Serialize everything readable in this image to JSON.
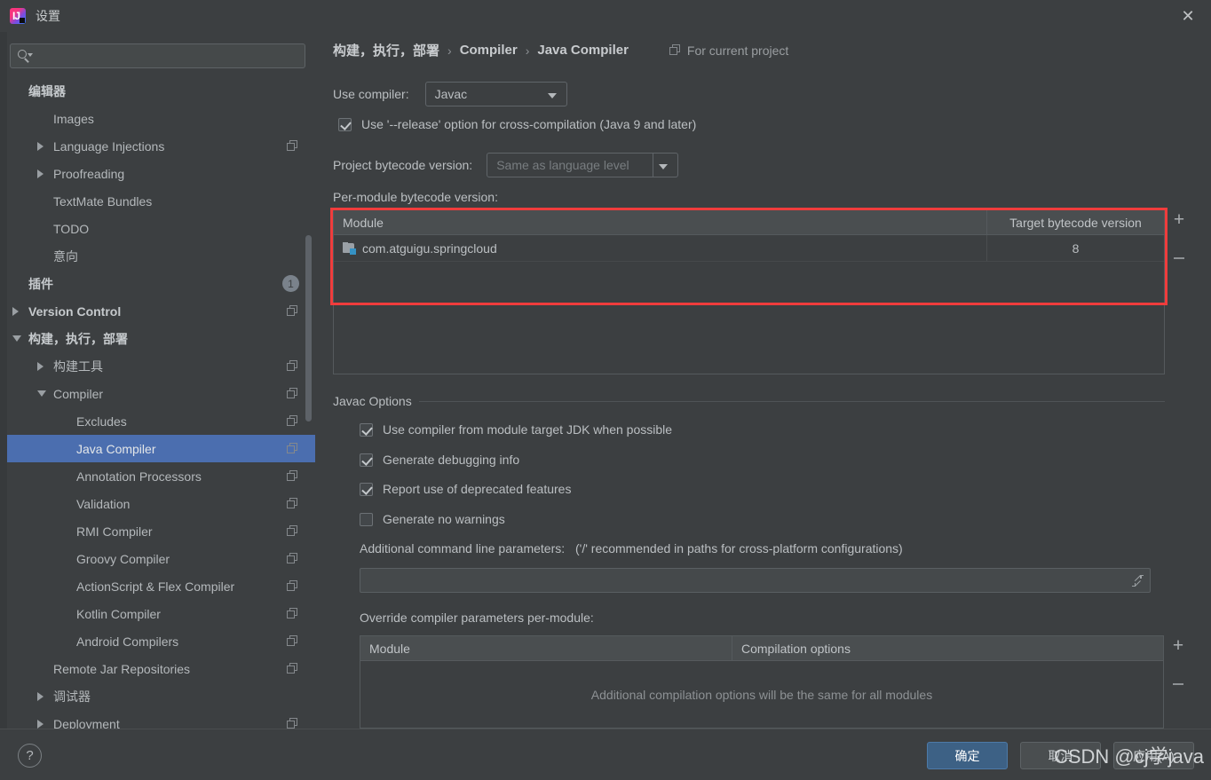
{
  "window": {
    "title": "设置",
    "app_icon": "intellij-idea-icon",
    "close_icon": "close-icon"
  },
  "search": {
    "placeholder": "",
    "value": "",
    "icon": "search-icon"
  },
  "sidebar": {
    "items": [
      {
        "label": "编辑器",
        "indent": 24,
        "twisty": "none",
        "bold": true,
        "copy": false,
        "badge": null,
        "selected": false
      },
      {
        "label": "Images",
        "indent": 52,
        "twisty": "none",
        "bold": false,
        "copy": false,
        "badge": null,
        "selected": false
      },
      {
        "label": "Language Injections",
        "indent": 52,
        "twisty": "collapsed",
        "bold": false,
        "copy": true,
        "badge": null,
        "selected": false
      },
      {
        "label": "Proofreading",
        "indent": 52,
        "twisty": "collapsed",
        "bold": false,
        "copy": false,
        "badge": null,
        "selected": false
      },
      {
        "label": "TextMate Bundles",
        "indent": 52,
        "twisty": "none",
        "bold": false,
        "copy": false,
        "badge": null,
        "selected": false
      },
      {
        "label": "TODO",
        "indent": 52,
        "twisty": "none",
        "bold": false,
        "copy": false,
        "badge": null,
        "selected": false
      },
      {
        "label": "意向",
        "indent": 52,
        "twisty": "none",
        "bold": false,
        "copy": false,
        "badge": null,
        "selected": false
      },
      {
        "label": "插件",
        "indent": 24,
        "twisty": "none",
        "bold": true,
        "copy": false,
        "badge": "1",
        "selected": false
      },
      {
        "label": "Version Control",
        "indent": 24,
        "twisty": "collapsed",
        "bold": true,
        "copy": true,
        "badge": null,
        "selected": false
      },
      {
        "label": "构建，执行，部署",
        "indent": 24,
        "twisty": "expanded",
        "bold": true,
        "copy": false,
        "badge": null,
        "selected": false
      },
      {
        "label": "构建工具",
        "indent": 52,
        "twisty": "collapsed",
        "bold": false,
        "copy": true,
        "badge": null,
        "selected": false
      },
      {
        "label": "Compiler",
        "indent": 52,
        "twisty": "expanded",
        "bold": false,
        "copy": true,
        "badge": null,
        "selected": false
      },
      {
        "label": "Excludes",
        "indent": 78,
        "twisty": "none",
        "bold": false,
        "copy": true,
        "badge": null,
        "selected": false
      },
      {
        "label": "Java Compiler",
        "indent": 78,
        "twisty": "none",
        "bold": false,
        "copy": true,
        "badge": null,
        "selected": true
      },
      {
        "label": "Annotation Processors",
        "indent": 78,
        "twisty": "none",
        "bold": false,
        "copy": true,
        "badge": null,
        "selected": false
      },
      {
        "label": "Validation",
        "indent": 78,
        "twisty": "none",
        "bold": false,
        "copy": true,
        "badge": null,
        "selected": false
      },
      {
        "label": "RMI Compiler",
        "indent": 78,
        "twisty": "none",
        "bold": false,
        "copy": true,
        "badge": null,
        "selected": false
      },
      {
        "label": "Groovy Compiler",
        "indent": 78,
        "twisty": "none",
        "bold": false,
        "copy": true,
        "badge": null,
        "selected": false
      },
      {
        "label": "ActionScript & Flex Compiler",
        "indent": 78,
        "twisty": "none",
        "bold": false,
        "copy": true,
        "badge": null,
        "selected": false
      },
      {
        "label": "Kotlin Compiler",
        "indent": 78,
        "twisty": "none",
        "bold": false,
        "copy": true,
        "badge": null,
        "selected": false
      },
      {
        "label": "Android Compilers",
        "indent": 78,
        "twisty": "none",
        "bold": false,
        "copy": true,
        "badge": null,
        "selected": false
      },
      {
        "label": "Remote Jar Repositories",
        "indent": 52,
        "twisty": "none",
        "bold": false,
        "copy": true,
        "badge": null,
        "selected": false
      },
      {
        "label": "调试器",
        "indent": 52,
        "twisty": "collapsed",
        "bold": false,
        "copy": false,
        "badge": null,
        "selected": false
      },
      {
        "label": "Deployment",
        "indent": 52,
        "twisty": "collapsed",
        "bold": false,
        "copy": true,
        "badge": null,
        "selected": false
      }
    ]
  },
  "breadcrumb": {
    "part1": "构建，执行，部署",
    "sep": "›",
    "part2": "Compiler",
    "part3": "Java Compiler",
    "scope_label": "For current project",
    "scope_icon": "copy-scope-icon"
  },
  "compiler": {
    "use_compiler_label": "Use compiler:",
    "use_compiler_value": "Javac",
    "release_option_label": "Use '--release' option for cross-compilation (Java 9 and later)",
    "release_option_checked": true,
    "project_bytecode_label": "Project bytecode version:",
    "project_bytecode_value": "Same as language level",
    "per_module_label": "Per-module bytecode version:"
  },
  "module_table": {
    "columns": [
      "Module",
      "Target bytecode version"
    ],
    "rows": [
      {
        "module": "com.atguigu.springcloud",
        "version": "8",
        "icon": "module-icon"
      }
    ],
    "add_label": "+",
    "remove_label": "−"
  },
  "javac_options": {
    "group_title": "Javac Options",
    "checkboxes": [
      {
        "label": "Use compiler from module target JDK when possible",
        "checked": true
      },
      {
        "label": "Generate debugging info",
        "checked": true
      },
      {
        "label": "Report use of deprecated features",
        "checked": true
      },
      {
        "label": "Generate no warnings",
        "checked": false
      }
    ],
    "additional_params_label": "Additional command line parameters:",
    "additional_params_hint": "('/' recommended in paths for cross-platform configurations)",
    "additional_params_value": "",
    "expand_icon": "expand-editor-icon",
    "override_label": "Override compiler parameters per-module:"
  },
  "override_table": {
    "columns": [
      "Module",
      "Compilation options"
    ],
    "empty_message": "Additional compilation options will be the same for all modules",
    "add_label": "+",
    "remove_label": "−"
  },
  "footer": {
    "help_label": "?",
    "ok_label": "确定",
    "cancel_label": "取消",
    "apply_label": "应用(A)"
  },
  "watermark": "CSDN @cj学java",
  "colors": {
    "background": "#3c3f41",
    "selection": "#4b6eaf",
    "annotation": "#f03c3c",
    "primary_button": "#3d6185",
    "module_chip": "#3592c4"
  }
}
